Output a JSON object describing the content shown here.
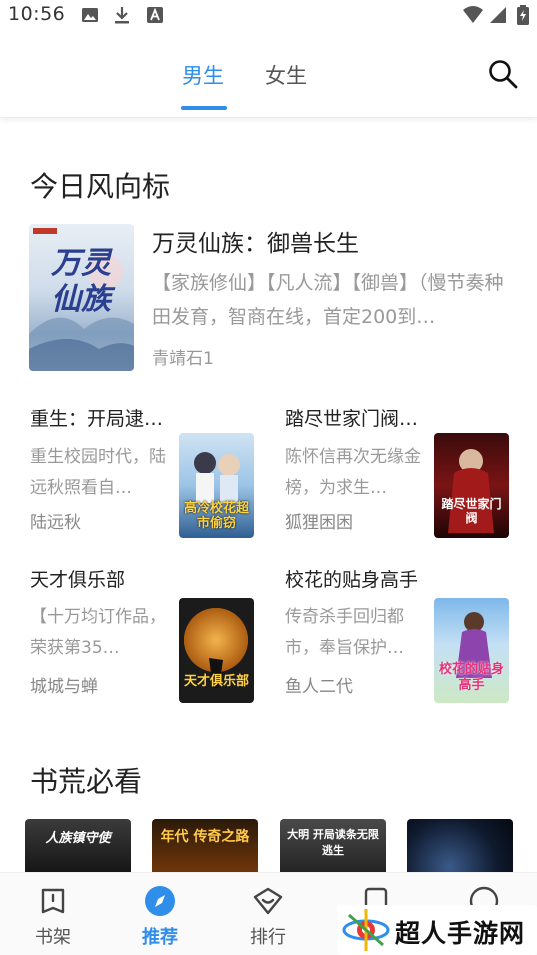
{
  "status_bar": {
    "time": "10:56"
  },
  "tabs": [
    {
      "label": "男生",
      "active": true
    },
    {
      "label": "女生",
      "active": false
    }
  ],
  "sections": {
    "vane": {
      "title": "今日风向标"
    },
    "must_read": {
      "title": "书荒必看"
    }
  },
  "featured": {
    "title": "万灵仙族：御兽长生",
    "description": "【家族修仙】【凡人流】【御兽】（慢节奏种田发育，智商在线，首定200到…",
    "author": "青靖石1",
    "cover_text": "万灵仙族"
  },
  "grid": [
    {
      "title": "重生：开局逮…",
      "description": "重生校园时代，陆远秋照看自…",
      "author": "陆远秋",
      "cover_text": "高冷校花超市偷窃"
    },
    {
      "title": "踏尽世家门阀…",
      "description": "陈怀信再次无缘金榜，为求生…",
      "author": "狐狸困困",
      "cover_text": "踏尽世家门阀"
    },
    {
      "title": "天才俱乐部",
      "description": "【十万均订作品，荣获第35…",
      "author": "城城与蝉",
      "cover_text": "天才俱乐部"
    },
    {
      "title": "校花的贴身高手",
      "description": "传奇杀手回归都市，奉旨保护…",
      "author": "鱼人二代",
      "cover_text": "校花的贴身高手"
    }
  ],
  "shelf_covers": [
    {
      "text": "人族镇守使"
    },
    {
      "text": "年代 传奇之路"
    },
    {
      "text": "大明 开局读条无限逃生"
    },
    {
      "text": ""
    }
  ],
  "bottom_nav": [
    {
      "label": "书架",
      "icon": "book-icon",
      "active": false
    },
    {
      "label": "推荐",
      "icon": "compass-icon",
      "active": true
    },
    {
      "label": "排行",
      "icon": "ranking-icon",
      "active": false
    }
  ],
  "watermark": {
    "text": "超人手游网"
  },
  "colors": {
    "accent": "#2f8ee9",
    "muted": "#999999"
  }
}
